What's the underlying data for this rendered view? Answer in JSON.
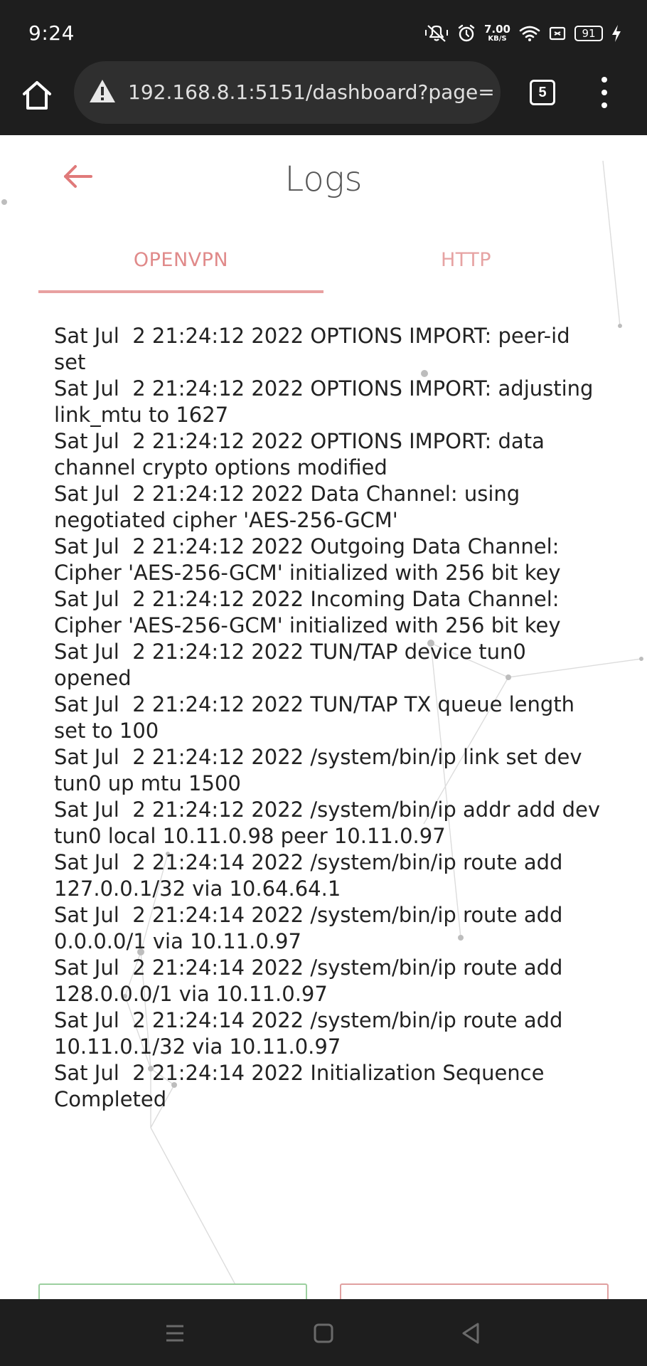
{
  "status_bar": {
    "time": "9:24",
    "net_speed_value": "7.00",
    "net_speed_unit": "KB/S",
    "battery": "91"
  },
  "browser": {
    "url": "192.168.8.1:5151/dashboard?page=",
    "tab_count": "5"
  },
  "page": {
    "title": "Logs",
    "tabs": [
      {
        "label": "OPENVPN",
        "active": true
      },
      {
        "label": "HTTP",
        "active": false
      }
    ],
    "log_lines": [
      "Sat Jul  2 21:24:12 2022 OPTIONS IMPORT: peer-id set",
      "Sat Jul  2 21:24:12 2022 OPTIONS IMPORT: adjusting link_mtu to 1627",
      "Sat Jul  2 21:24:12 2022 OPTIONS IMPORT: data channel crypto options modified",
      "Sat Jul  2 21:24:12 2022 Data Channel: using negotiated cipher 'AES-256-GCM'",
      "Sat Jul  2 21:24:12 2022 Outgoing Data Channel: Cipher 'AES-256-GCM' initialized with 256 bit key",
      "Sat Jul  2 21:24:12 2022 Incoming Data Channel: Cipher 'AES-256-GCM' initialized with 256 bit key",
      "Sat Jul  2 21:24:12 2022 TUN/TAP device tun0 opened",
      "Sat Jul  2 21:24:12 2022 TUN/TAP TX queue length set to 100",
      "Sat Jul  2 21:24:12 2022 /system/bin/ip link set dev tun0 up mtu 1500",
      "Sat Jul  2 21:24:12 2022 /system/bin/ip addr add dev tun0 local 10.11.0.98 peer 10.11.0.97",
      "Sat Jul  2 21:24:14 2022 /system/bin/ip route add 127.0.0.1/32 via 10.64.64.1",
      "Sat Jul  2 21:24:14 2022 /system/bin/ip route add 0.0.0.0/1 via 10.11.0.97",
      "Sat Jul  2 21:24:14 2022 /system/bin/ip route add 128.0.0.0/1 via 10.11.0.97",
      "Sat Jul  2 21:24:14 2022 /system/bin/ip route add 10.11.0.1/32 via 10.11.0.97",
      "Sat Jul  2 21:24:14 2022 Initialization Sequence Completed"
    ]
  },
  "colors": {
    "accent": "#e08a8a",
    "system_bar": "#1e1e1e",
    "url_bar": "#2f2f2f"
  }
}
